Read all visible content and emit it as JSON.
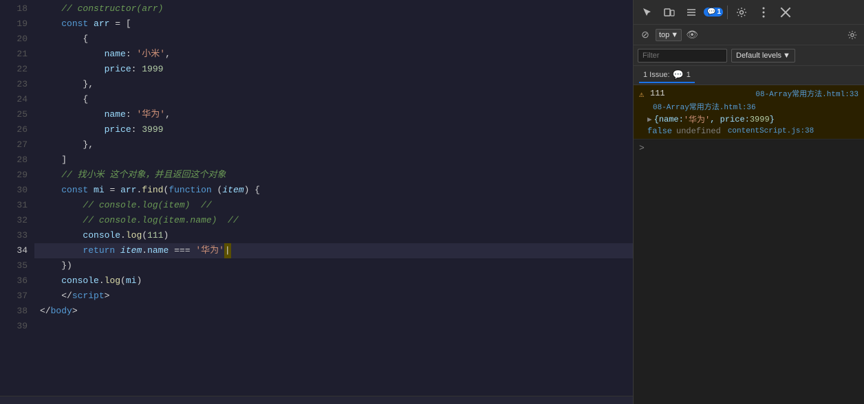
{
  "editor": {
    "lines": [
      {
        "num": 18,
        "content": [
          {
            "t": "punc",
            "v": "    "
          }
        ],
        "active": false
      },
      {
        "num": 19,
        "content": [],
        "active": false
      },
      {
        "num": 20,
        "content": [],
        "active": false
      },
      {
        "num": 21,
        "content": [],
        "active": false
      },
      {
        "num": 22,
        "content": [],
        "active": false
      },
      {
        "num": 23,
        "content": [],
        "active": false
      },
      {
        "num": 24,
        "content": [],
        "active": false
      },
      {
        "num": 25,
        "content": [],
        "active": false
      },
      {
        "num": 26,
        "content": [],
        "active": false
      },
      {
        "num": 27,
        "content": [],
        "active": false
      },
      {
        "num": 28,
        "content": [],
        "active": false
      },
      {
        "num": 29,
        "content": [],
        "active": false
      },
      {
        "num": 30,
        "content": [],
        "active": false
      },
      {
        "num": 31,
        "content": [],
        "active": false
      },
      {
        "num": 32,
        "content": [],
        "active": false
      },
      {
        "num": 33,
        "content": [],
        "active": false
      },
      {
        "num": 34,
        "content": [],
        "active": true
      },
      {
        "num": 35,
        "content": [],
        "active": false
      },
      {
        "num": 36,
        "content": [],
        "active": false
      },
      {
        "num": 37,
        "content": [],
        "active": false
      },
      {
        "num": 38,
        "content": [],
        "active": false
      },
      {
        "num": 39,
        "content": [],
        "active": false
      }
    ]
  },
  "devtools": {
    "toolbar": {
      "badge_count": "1",
      "badge_label": "1"
    },
    "console": {
      "top_label": "top",
      "filter_placeholder": "Filter",
      "default_levels_label": "Default levels"
    },
    "issues": {
      "label": "1 Issue:",
      "count": "1"
    },
    "entries": [
      {
        "type": "warn",
        "value": "111",
        "link1": "08-Array常用方法.html:33",
        "link2": "08-Array常用方法.html:36",
        "obj": "{name: '华为', price: 3999}",
        "row3_kw": "false",
        "row3_undef": "undefined",
        "row3_link": "contentScript.js:38"
      }
    ]
  }
}
